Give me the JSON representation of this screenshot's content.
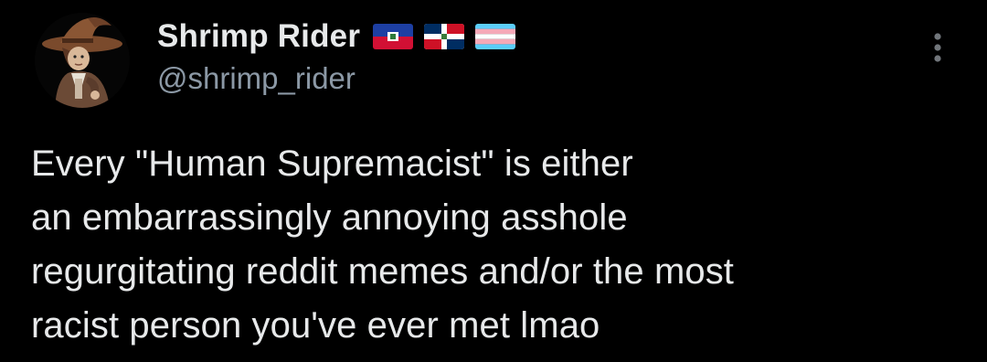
{
  "author": {
    "display_name": "Shrimp Rider",
    "handle": "@shrimp_rider",
    "avatar_icon": "wizard-hat-character-avatar",
    "flag_icons": [
      "haiti-flag-icon",
      "dominican-republic-flag-icon",
      "transgender-pride-flag-icon"
    ]
  },
  "menu": {
    "icon": "more-vertical-icon"
  },
  "tweet": {
    "lines": [
      "Every \"Human Supremacist\" is either",
      "an embarrassingly annoying asshole",
      "regurgitating reddit memes and/or the most",
      "racist person you've ever met lmao"
    ]
  },
  "colors": {
    "background": "#000000",
    "primary_text": "#e7e9ea",
    "secondary_text": "#8b98a5"
  }
}
